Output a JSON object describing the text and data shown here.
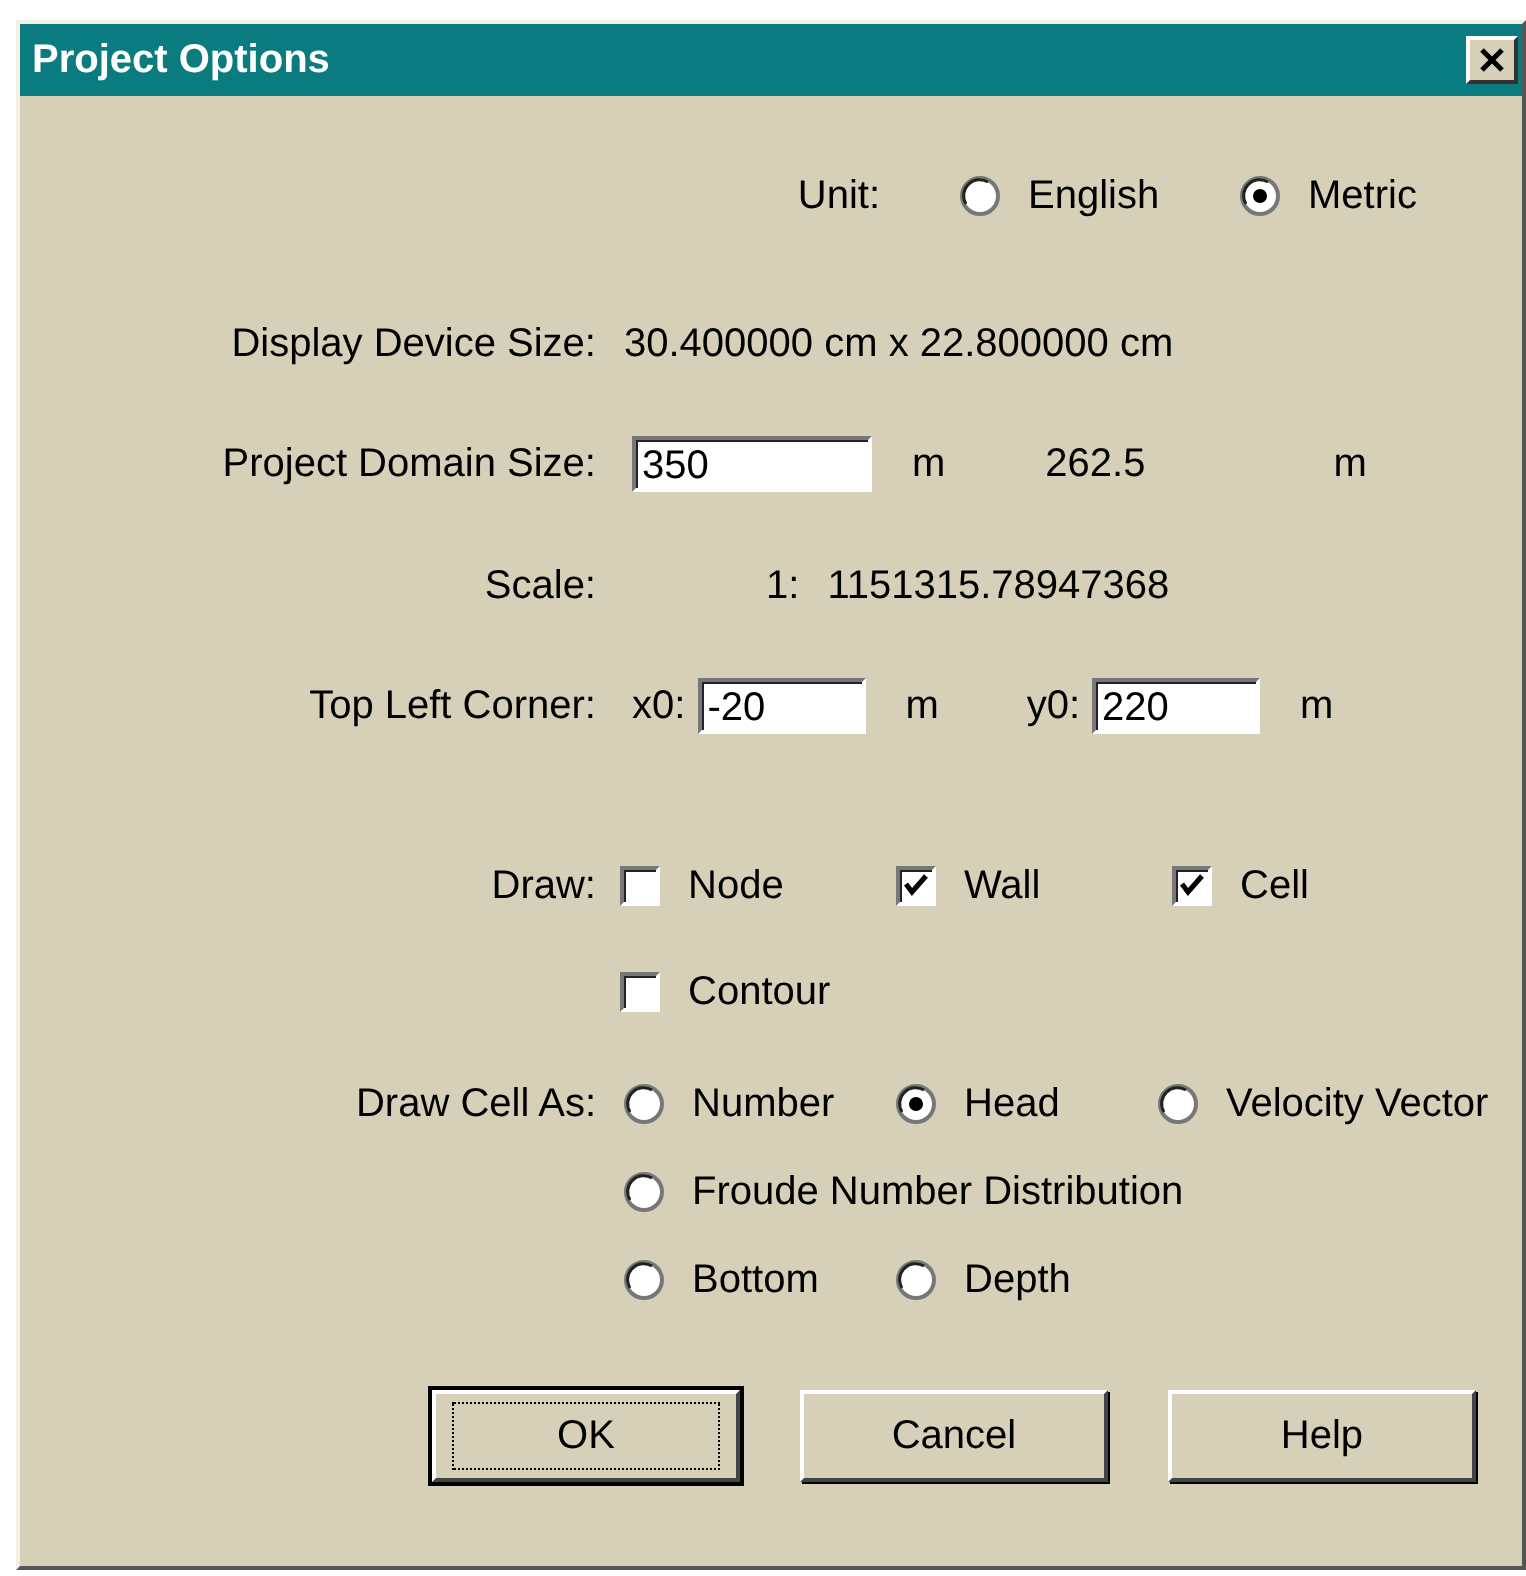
{
  "window": {
    "title": "Project Options"
  },
  "unit": {
    "label": "Unit:",
    "options": [
      {
        "label": "English",
        "selected": false
      },
      {
        "label": "Metric",
        "selected": true
      }
    ]
  },
  "display_device_size": {
    "label": "Display Device Size:",
    "value": "30.400000 cm x 22.800000 cm"
  },
  "project_domain_size": {
    "label": "Project Domain Size:",
    "value": "350",
    "unit": "m",
    "second_value": "262.5",
    "second_unit": "m"
  },
  "scale": {
    "label": "Scale:",
    "prefix": "1:",
    "value": "1151315.78947368"
  },
  "top_left_corner": {
    "label": "Top Left Corner:",
    "fields": [
      {
        "label": "x0:",
        "value": "-20",
        "unit": "m"
      },
      {
        "label": "y0:",
        "value": "220",
        "unit": "m"
      }
    ]
  },
  "draw": {
    "label": "Draw:",
    "rows": [
      [
        {
          "label": "Node",
          "checked": false
        },
        {
          "label": "Wall",
          "checked": true
        },
        {
          "label": "Cell",
          "checked": true
        }
      ],
      [
        {
          "label": "Contour",
          "checked": false
        }
      ]
    ]
  },
  "draw_cell_as": {
    "label": "Draw Cell As:",
    "rows": [
      [
        {
          "label": "Number",
          "selected": false
        },
        {
          "label": "Head",
          "selected": true
        },
        {
          "label": "Velocity Vector",
          "selected": false
        }
      ],
      [
        {
          "label": "Froude Number Distribution",
          "selected": false
        }
      ],
      [
        {
          "label": "Bottom",
          "selected": false
        },
        {
          "label": "Depth",
          "selected": false
        }
      ]
    ]
  },
  "buttons": [
    {
      "label": "OK",
      "default": true
    },
    {
      "label": "Cancel",
      "default": false
    },
    {
      "label": "Help",
      "default": false
    }
  ]
}
